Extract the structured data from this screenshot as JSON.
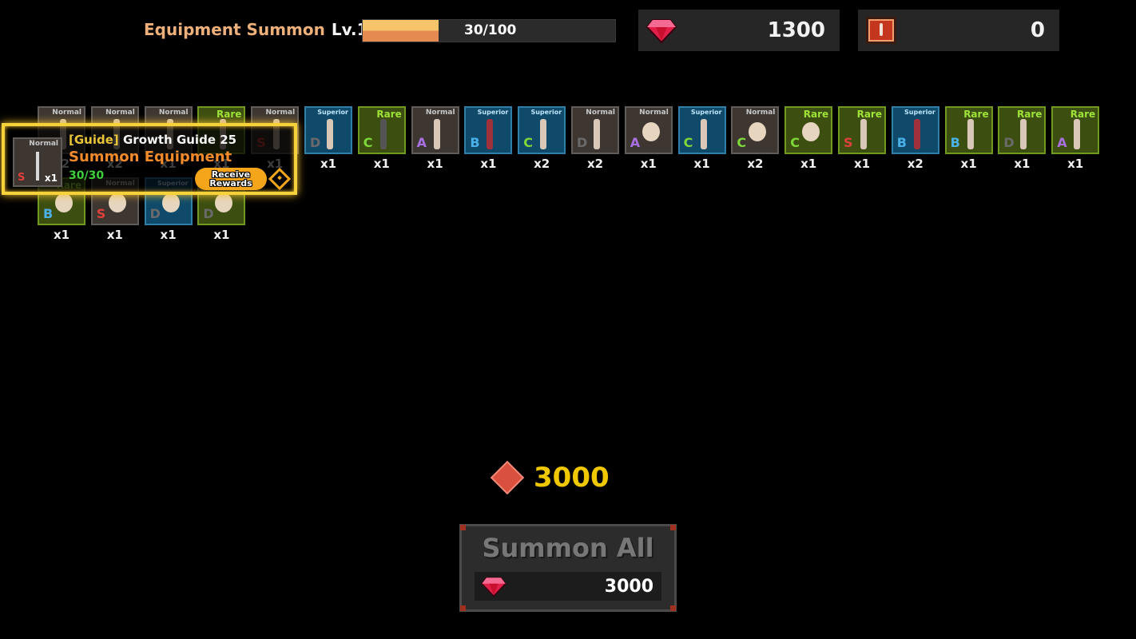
{
  "header": {
    "title": "Equipment Summon",
    "level": "Lv.1",
    "progress_text": "30/100",
    "progress_fraction": 0.3
  },
  "currencies": [
    {
      "icon": "gem-icon",
      "value": "1300"
    },
    {
      "icon": "summon-ticket-icon",
      "value": "0"
    }
  ],
  "items": [
    {
      "rarity": "Normal",
      "grade": "",
      "count": "x2",
      "weapon": "sword"
    },
    {
      "rarity": "Normal",
      "grade": "",
      "count": "x2",
      "weapon": "sword"
    },
    {
      "rarity": "Normal",
      "grade": "",
      "count": "x1",
      "weapon": "sword"
    },
    {
      "rarity": "Rare",
      "grade": "",
      "count": "x1",
      "weapon": "sword"
    },
    {
      "rarity": "Normal",
      "grade": "S",
      "count": "x1",
      "weapon": "sword"
    },
    {
      "rarity": "Superior",
      "grade": "D",
      "count": "x1",
      "weapon": "sword"
    },
    {
      "rarity": "Rare",
      "grade": "C",
      "count": "x1",
      "weapon": "scythe"
    },
    {
      "rarity": "Normal",
      "grade": "A",
      "count": "x1",
      "weapon": "sword"
    },
    {
      "rarity": "Superior",
      "grade": "B",
      "count": "x1",
      "weapon": "greatsword"
    },
    {
      "rarity": "Superior",
      "grade": "C",
      "count": "x2",
      "weapon": "sword"
    },
    {
      "rarity": "Normal",
      "grade": "D",
      "count": "x2",
      "weapon": "sword"
    },
    {
      "rarity": "Normal",
      "grade": "A",
      "count": "x1",
      "weapon": "shield"
    },
    {
      "rarity": "Superior",
      "grade": "C",
      "count": "x1",
      "weapon": "sword"
    },
    {
      "rarity": "Normal",
      "grade": "C",
      "count": "x2",
      "weapon": "shield"
    },
    {
      "rarity": "Rare",
      "grade": "C",
      "count": "x1",
      "weapon": "shield"
    },
    {
      "rarity": "Rare",
      "grade": "S",
      "count": "x1",
      "weapon": "sword"
    },
    {
      "rarity": "Superior",
      "grade": "B",
      "count": "x2",
      "weapon": "greatsword"
    },
    {
      "rarity": "Rare",
      "grade": "B",
      "count": "x1",
      "weapon": "sword"
    },
    {
      "rarity": "Rare",
      "grade": "D",
      "count": "x1",
      "weapon": "sword"
    },
    {
      "rarity": "Rare",
      "grade": "A",
      "count": "x1",
      "weapon": "sword"
    },
    {
      "rarity": "Rare",
      "grade": "B",
      "count": "x1",
      "weapon": "shield"
    },
    {
      "rarity": "Normal",
      "grade": "S",
      "count": "x1",
      "weapon": "shield"
    },
    {
      "rarity": "Superior",
      "grade": "D",
      "count": "x1",
      "weapon": "shield"
    },
    {
      "rarity": "Rare",
      "grade": "D",
      "count": "x1",
      "weapon": "shield"
    }
  ],
  "guide": {
    "tag": "[Guide]",
    "name": "Growth Guide 25",
    "task": "Summon Equipment",
    "progress": "30/30",
    "item": {
      "rarity": "Normal",
      "grade": "S",
      "count": "x1"
    },
    "receive_label": "Receive Rewards"
  },
  "cost": {
    "value": "3000"
  },
  "summon_all": {
    "label": "Summon All",
    "cost": "3000"
  }
}
